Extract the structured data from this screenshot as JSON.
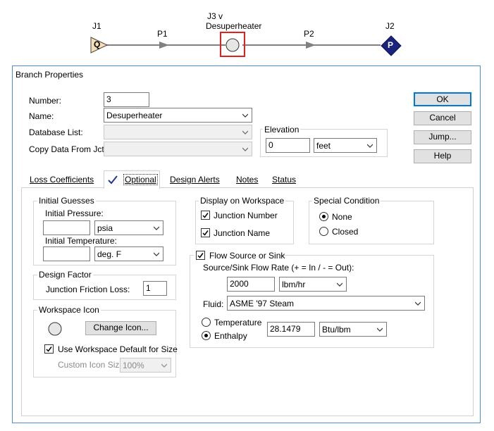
{
  "diagram": {
    "j1_label": "J1",
    "j1_symbol": "Q",
    "p1_label": "P1",
    "j3_label_line1": "J3 v",
    "j3_label_line2": "Desuperheater",
    "p2_label": "P2",
    "j2_label": "J2",
    "j2_symbol": "P",
    "colors": {
      "j1_fill": "#f5deb3",
      "j2_fill": "#1a237e",
      "selection": "#e02020",
      "pipe": "#808080"
    }
  },
  "dialog": {
    "title": "Branch Properties",
    "number_label": "Number:",
    "number_value": "3",
    "name_label": "Name:",
    "name_value": "Desuperheater",
    "database_label": "Database List:",
    "database_value": "",
    "copy_label": "Copy Data From Jct...",
    "copy_value": "",
    "elevation_group": "Elevation",
    "elevation_value": "0",
    "elevation_unit": "feet",
    "buttons": {
      "ok": "OK",
      "cancel": "Cancel",
      "jump": "Jump...",
      "help": "Help"
    },
    "tabs": [
      "Loss Coefficients",
      "Optional",
      "Design Alerts",
      "Notes",
      "Status"
    ],
    "active_tab": "Optional",
    "optional": {
      "initial_guesses": {
        "title": "Initial Guesses",
        "pressure_label": "Initial Pressure:",
        "pressure_value": "",
        "pressure_unit": "psia",
        "temperature_label": "Initial Temperature:",
        "temperature_value": "",
        "temperature_unit": "deg. F"
      },
      "design_factor": {
        "title": "Design Factor",
        "friction_label": "Junction Friction Loss:",
        "friction_value": "1"
      },
      "workspace_icon": {
        "title": "Workspace Icon",
        "change_button": "Change Icon...",
        "use_default_label": "Use Workspace Default for Size",
        "use_default_checked": true,
        "custom_size_label": "Custom Icon Size:",
        "custom_size_value": "100%"
      },
      "display": {
        "title": "Display on Workspace",
        "junction_number": "Junction Number",
        "junction_number_checked": true,
        "junction_name": "Junction Name",
        "junction_name_checked": true
      },
      "special_condition": {
        "title": "Special Condition",
        "none": "None",
        "closed": "Closed",
        "selected": "None"
      },
      "flow_source": {
        "title": "Flow Source or Sink",
        "checked": true,
        "rate_label": "Source/Sink Flow Rate (+ = In / - = Out):",
        "rate_value": "2000",
        "rate_unit": "lbm/hr",
        "fluid_label": "Fluid:",
        "fluid_value": "ASME '97 Steam",
        "temperature_label": "Temperature",
        "enthalpy_label": "Enthalpy",
        "selected": "Enthalpy",
        "enthalpy_value": "28.1479",
        "enthalpy_unit": "Btu/lbm"
      }
    }
  }
}
